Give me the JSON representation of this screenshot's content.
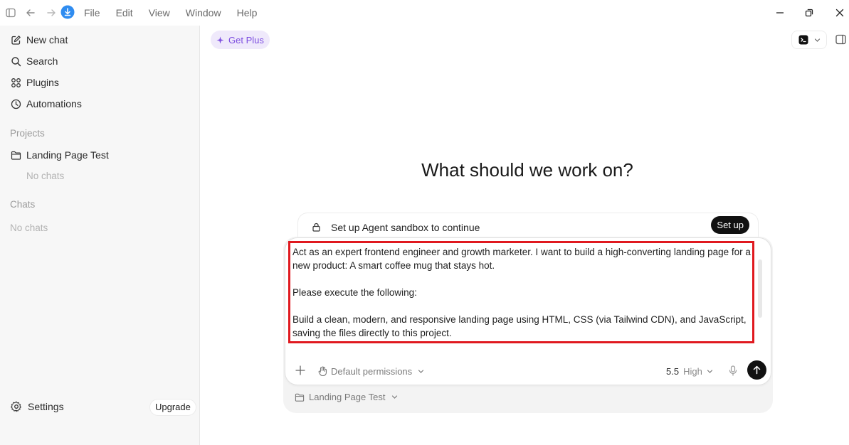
{
  "menu": [
    "File",
    "Edit",
    "View",
    "Window",
    "Help"
  ],
  "sidebar": {
    "nav": [
      {
        "label": "New chat",
        "icon": "compose-icon"
      },
      {
        "label": "Search",
        "icon": "search-icon"
      },
      {
        "label": "Plugins",
        "icon": "plugins-icon"
      },
      {
        "label": "Automations",
        "icon": "clock-icon"
      }
    ],
    "projects_label": "Projects",
    "project_name": "Landing Page Test",
    "project_empty": "No chats",
    "chats_label": "Chats",
    "chats_empty": "No chats",
    "settings_label": "Settings",
    "upgrade_label": "Upgrade"
  },
  "header": {
    "get_plus_label": "Get Plus"
  },
  "main": {
    "heading": "What should we work on?",
    "sandbox_text": "Set up Agent sandbox to continue",
    "setup_label": "Set up",
    "prompt_text": "Act as an expert frontend engineer and growth marketer. I want to build a high-converting landing page for a new product: A smart coffee mug that stays hot.\n\nPlease execute the following:\n\nBuild a clean, modern, and responsive landing page using HTML, CSS (via Tailwind CDN), and JavaScript, saving the files directly to this project.",
    "permissions_label": "Default permissions",
    "model_version": "5.5",
    "model_effort": "High",
    "project_pill_label": "Landing Page Test"
  },
  "colors": {
    "accent_purple": "#7d4ee0",
    "highlight_red": "#e0191f",
    "download_blue": "#2f8cf0"
  }
}
